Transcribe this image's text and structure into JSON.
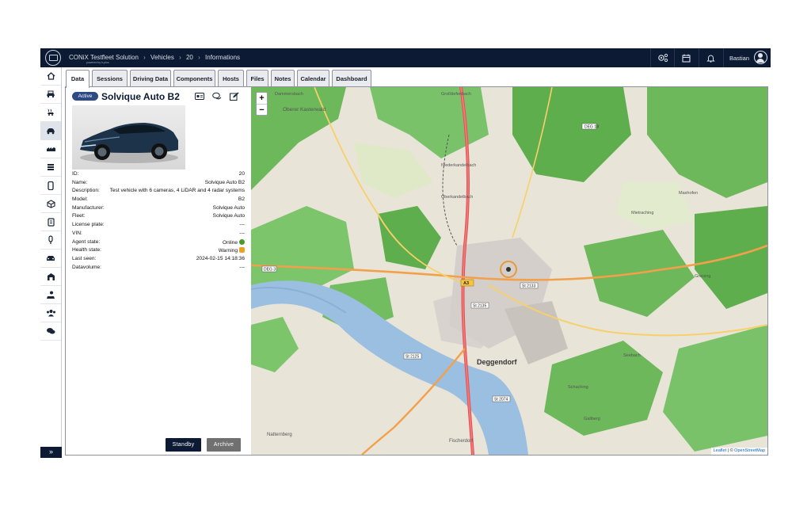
{
  "header": {
    "app_name": "CONiX Testfleet Solution",
    "powered_by": "powered by b-plus",
    "breadcrumb": [
      "Vehicles",
      "20",
      "Informations"
    ],
    "username": "Bastian"
  },
  "tabs": [
    "Data",
    "Sessions",
    "Driving Data",
    "Components",
    "Hosts",
    "Files",
    "Notes",
    "Calendar",
    "Dashboard"
  ],
  "vehicle": {
    "status": "Active",
    "title": "Solvique Auto B2",
    "fields": [
      {
        "label": "ID:",
        "value": "20"
      },
      {
        "label": "Name:",
        "value": "Solvique Auto B2"
      },
      {
        "label": "Description:",
        "value": "Test vehicle with 6 cameras, 4 LiDAR and 4 radar systems"
      },
      {
        "label": "Model:",
        "value": "B2"
      },
      {
        "label": "Manufacturer:",
        "value": "Solvique Auto"
      },
      {
        "label": "Fleet:",
        "value": "Solvique Auto"
      },
      {
        "label": "License plate:",
        "value": "---"
      },
      {
        "label": "VIN:",
        "value": "---"
      },
      {
        "label": "Agent state:",
        "value": "Online"
      },
      {
        "label": "Health state:",
        "value": "Warning"
      },
      {
        "label": "Last seen:",
        "value": "2024-02-15 14:18:36"
      },
      {
        "label": "Datavolume:",
        "value": "---"
      }
    ]
  },
  "actions": {
    "standby": "Standby",
    "archive": "Archive"
  },
  "map": {
    "zoom_in": "+",
    "zoom_out": "−",
    "attribution_leaflet": "Leaflet",
    "attribution_sep": " | © ",
    "attribution_osm": "OpenStreetMap",
    "city_label": "Deggendorf",
    "labels": [
      "Oberer Kasterwald",
      "Dammersbach",
      "Großtiefenbach",
      "Niederkandelbach",
      "Oberkandelbach",
      "Mietraching",
      "Maxhofen",
      "Natternberg",
      "Fischerdorf",
      "Schaching",
      "Seebach",
      "Greising",
      "Gallberg"
    ],
    "road_labels": [
      "DEG 19",
      "DEG 3",
      "St 2135",
      "St 2125",
      "St 2074",
      "St 2133",
      "A3"
    ]
  },
  "colors": {
    "navy": "#0c1b33",
    "active_badge": "#2e4a85",
    "online": "#4a9a2a",
    "warning": "#f0a020",
    "standby_btn": "#0c1b33",
    "archive_btn": "#707070"
  },
  "icons": {
    "sidebar": [
      "home-icon",
      "vehicles-icon",
      "car-wash-icon",
      "car-icon",
      "fleet-icon",
      "list-icon",
      "phone-icon",
      "cube-icon",
      "storage-icon",
      "sensor-icon",
      "car-front-icon",
      "building-icon",
      "person-car-icon",
      "users-icon",
      "chat-icon"
    ],
    "topbar": [
      "settings-icon",
      "calendar-icon",
      "bell-icon",
      "user-icon"
    ]
  }
}
